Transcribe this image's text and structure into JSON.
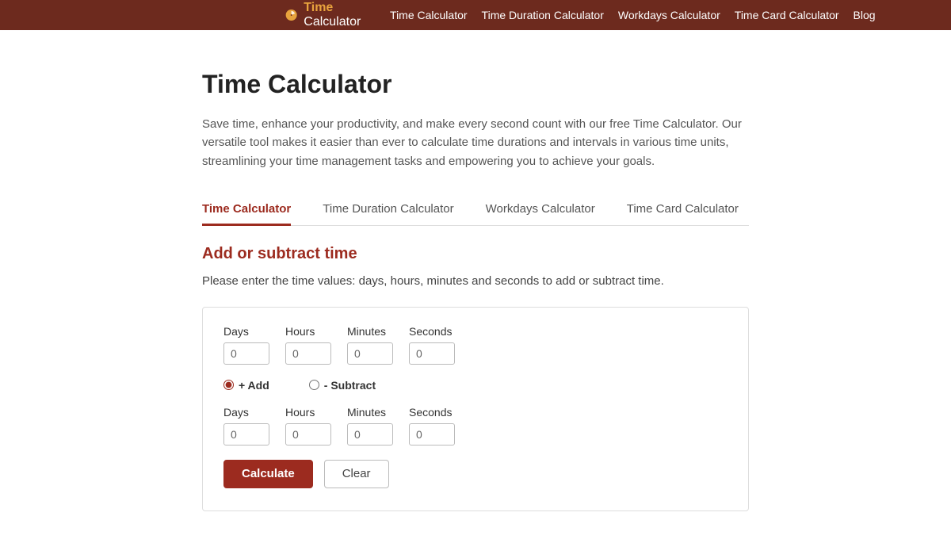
{
  "header": {
    "logo_time": "Time",
    "logo_calc": "Calculator",
    "nav": [
      "Time Calculator",
      "Time Duration Calculator",
      "Workdays Calculator",
      "Time Card Calculator",
      "Blog"
    ]
  },
  "page": {
    "title": "Time Calculator",
    "desc": "Save time, enhance your productivity, and make every second count with our free Time Calculator. Our versatile tool makes it easier than ever to calculate time durations and intervals in various time units, streamlining your time management tasks and empowering you to achieve your goals."
  },
  "tabs": [
    "Time Calculator",
    "Time Duration Calculator",
    "Workdays Calculator",
    "Time Card Calculator"
  ],
  "section": {
    "title": "Add or subtract time",
    "desc": "Please enter the time values: days, hours, minutes and seconds to add or subtract time."
  },
  "labels": {
    "days": "Days",
    "hours": "Hours",
    "minutes": "Minutes",
    "seconds": "Seconds",
    "add": "+ Add",
    "subtract": "- Subtract",
    "calculate": "Calculate",
    "clear": "Clear"
  },
  "values": {
    "row1": {
      "days": "0",
      "hours": "0",
      "minutes": "0",
      "seconds": "0"
    },
    "row2": {
      "days": "0",
      "hours": "0",
      "minutes": "0",
      "seconds": "0"
    }
  }
}
